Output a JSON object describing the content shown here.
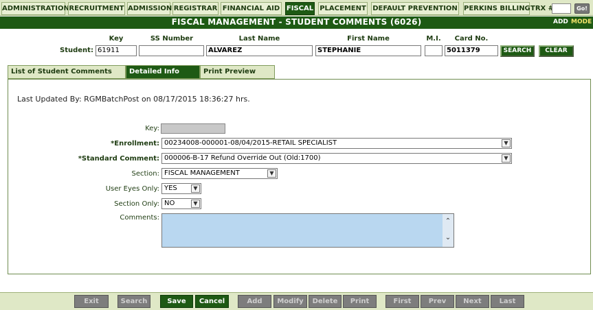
{
  "nav": {
    "tabs": [
      {
        "label": "ADMINISTRATION"
      },
      {
        "label": "RECRUITMENT"
      },
      {
        "label": "ADMISSION"
      },
      {
        "label": "REGISTRAR"
      },
      {
        "label": "FINANCIAL AID"
      },
      {
        "label": "FISCAL"
      },
      {
        "label": "PLACEMENT"
      },
      {
        "label": "DEFAULT PREVENTION"
      },
      {
        "label": "PERKINS BILLING"
      }
    ],
    "active_tab": "FISCAL",
    "trx_label": "TRX #:",
    "trx_value": "",
    "go_label": "Go!"
  },
  "header": {
    "title": "FISCAL MANAGEMENT - STUDENT COMMENTS (6026)",
    "mode_action": "ADD",
    "mode_word": "MODE"
  },
  "student": {
    "row_label": "Student:",
    "columns": {
      "key": "Key",
      "ssn": "SS Number",
      "last_name": "Last Name",
      "first_name": "First Name",
      "mi": "M.I.",
      "card_no": "Card No."
    },
    "values": {
      "key": "61911",
      "ssn": "",
      "last_name": "ALVAREZ",
      "first_name": "STEPHANIE",
      "mi": "",
      "card_no": "5011379"
    },
    "search_label": "SEARCH",
    "clear_label": "CLEAR"
  },
  "subtabs": [
    {
      "label": "List of Student Comments"
    },
    {
      "label": "Detailed Info"
    },
    {
      "label": "Print Preview"
    }
  ],
  "panel": {
    "updated_by": "Last Updated By: RGMBatchPost on 08/17/2015 18:36:27 hrs."
  },
  "form": {
    "key_label": "Key:",
    "key_value": "",
    "enrollment_label": "*Enrollment:",
    "enrollment_value": "00234008-000001-08/04/2015-RETAIL SPECIALIST",
    "standard_comment_label": "*Standard Comment:",
    "standard_comment_value": "000006-B-17 Refund Override Out (Old:1700)",
    "section_label": "Section:",
    "section_value": "FISCAL MANAGEMENT",
    "user_eyes_label": "User Eyes Only:",
    "user_eyes_value": "YES",
    "section_only_label": "Section Only:",
    "section_only_value": "NO",
    "comments_label": "Comments:",
    "comments_value": ""
  },
  "toolbar": {
    "buttons": [
      {
        "label": "Exit",
        "enabled": false
      },
      {
        "label": "Search",
        "enabled": false
      },
      {
        "label": "Save",
        "enabled": true
      },
      {
        "label": "Cancel",
        "enabled": true
      },
      {
        "label": "Add",
        "enabled": false
      },
      {
        "label": "Modify",
        "enabled": false
      },
      {
        "label": "Delete",
        "enabled": false
      },
      {
        "label": "Print",
        "enabled": false
      },
      {
        "label": "First",
        "enabled": false
      },
      {
        "label": "Prev",
        "enabled": false
      },
      {
        "label": "Next",
        "enabled": false
      },
      {
        "label": "Last",
        "enabled": false
      }
    ]
  },
  "colors": {
    "brand_green": "#1e5a14",
    "nav_bg": "#dfe8c6",
    "mode_accent": "#f3e46a",
    "comments_bg": "#b9d7f0"
  },
  "icons": {
    "dropdown": "chevron-down-icon",
    "scroll_up": "chevron-up-icon",
    "scroll_down": "chevron-down-icon"
  }
}
